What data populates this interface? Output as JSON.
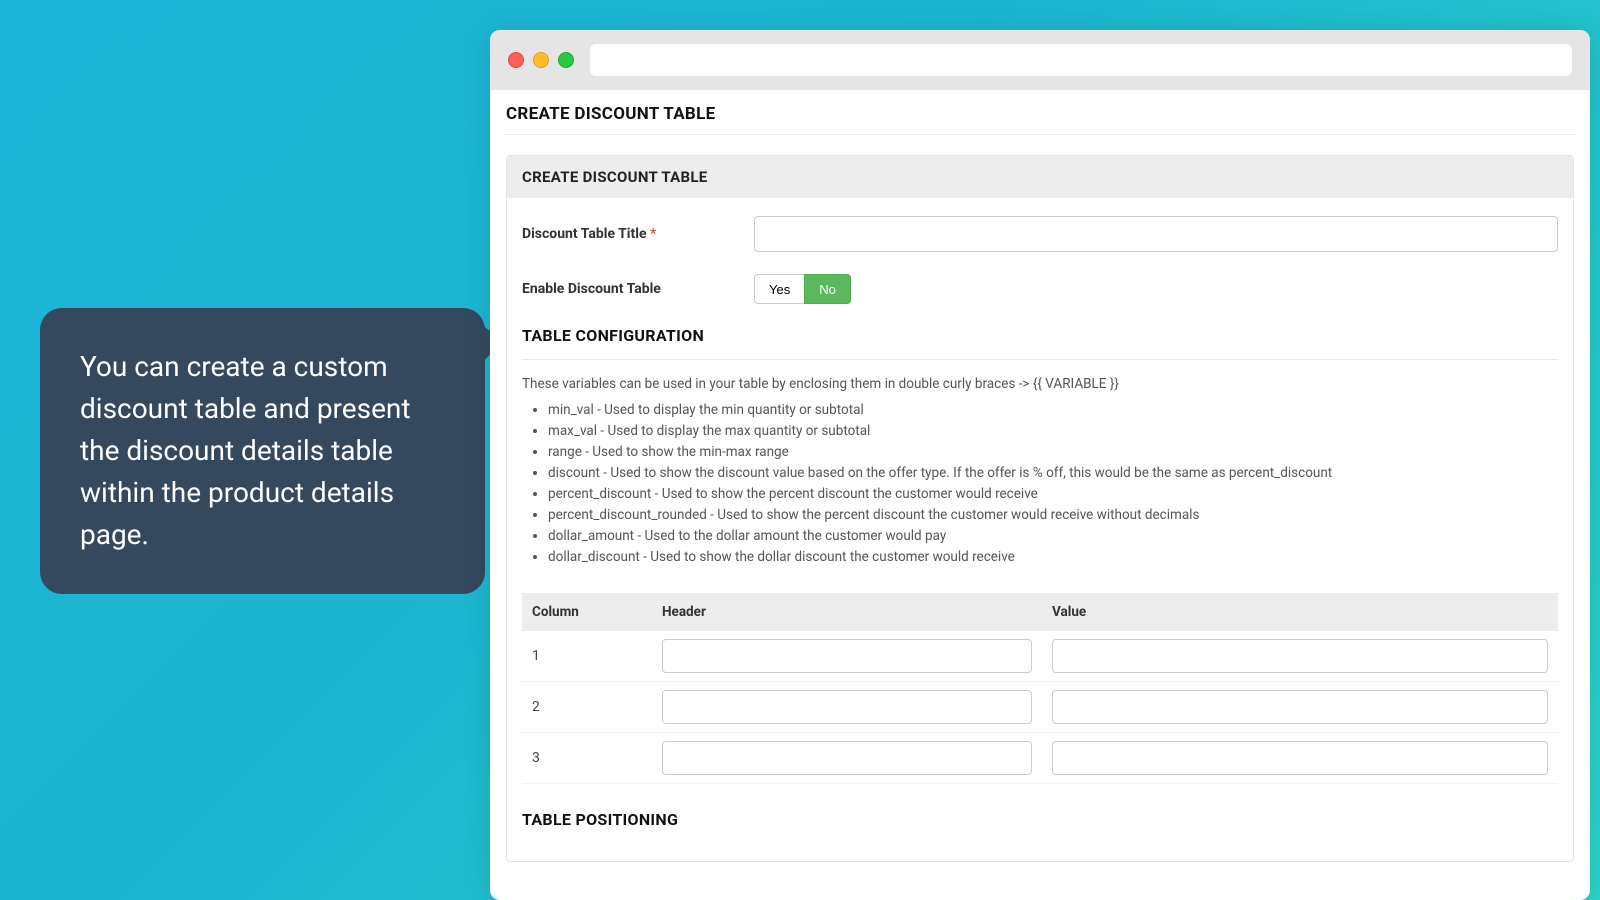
{
  "tooltip": {
    "text": "You can create a custom discount table and present the discount details table within the product details page."
  },
  "page": {
    "title": "CREATE DISCOUNT TABLE"
  },
  "panel": {
    "header": "CREATE DISCOUNT TABLE",
    "titleField": {
      "label": "Discount Table Title",
      "required": "*",
      "value": ""
    },
    "enableField": {
      "label": "Enable Discount Table",
      "yes": "Yes",
      "no": "No"
    },
    "configTitle": "TABLE CONFIGURATION",
    "helpIntro": "These variables can be used in your table by enclosing them in double curly braces -> {{ VARIABLE }}",
    "helpItems": [
      "min_val - Used to display the min quantity or subtotal",
      "max_val - Used to display the max quantity or subtotal",
      "range - Used to show the min-max range",
      "discount - Used to show the discount value based on the offer type. If the offer is % off, this would be the same as percent_discount",
      "percent_discount - Used to show the percent discount the customer would receive",
      "percent_discount_rounded - Used to show the percent discount the customer would receive without decimals",
      "dollar_amount - Used to the dollar amount the customer would pay",
      "dollar_discount - Used to show the dollar discount the customer would receive"
    ],
    "columnsHeader": {
      "col": "Column",
      "header": "Header",
      "value": "Value"
    },
    "rows": [
      {
        "n": "1",
        "header": "",
        "value": ""
      },
      {
        "n": "2",
        "header": "",
        "value": ""
      },
      {
        "n": "3",
        "header": "",
        "value": ""
      }
    ],
    "positioningTitle": "TABLE POSITIONING"
  }
}
